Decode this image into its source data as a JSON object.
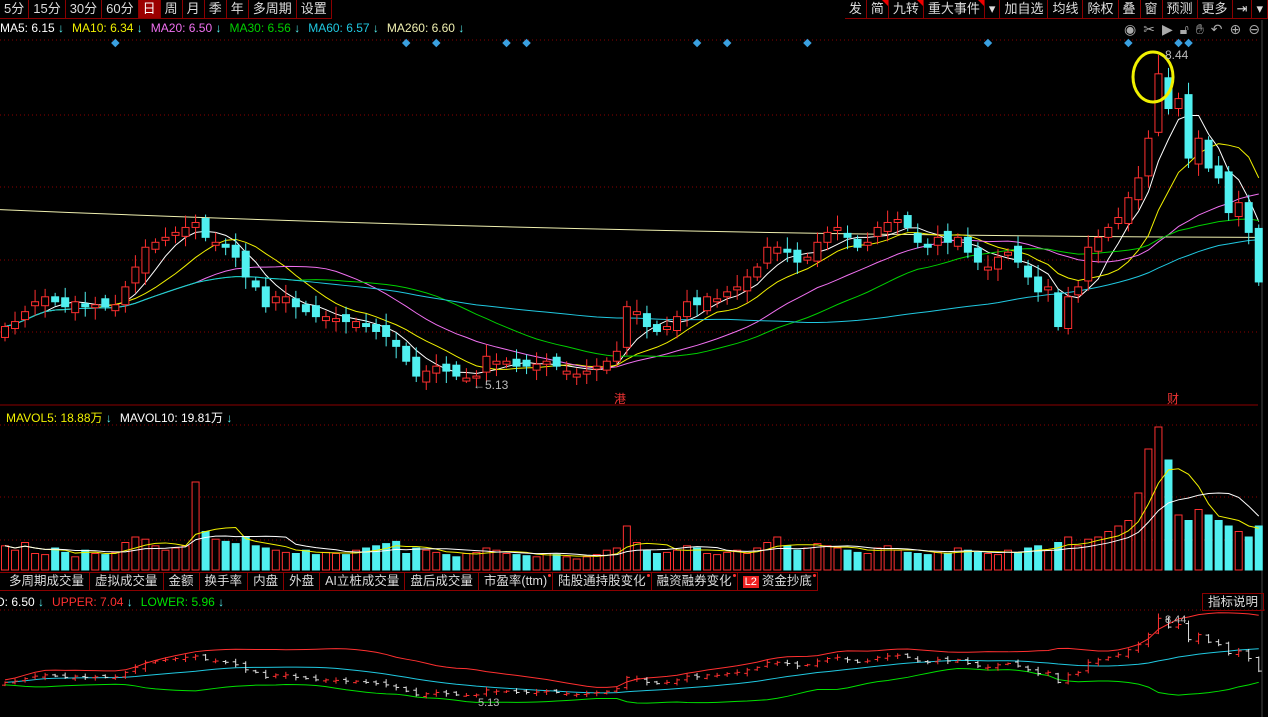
{
  "toolbar": {
    "periods": [
      "5分",
      "15分",
      "30分",
      "60分",
      "日",
      "周",
      "月",
      "季",
      "年",
      "多周期",
      "设置"
    ],
    "active": "日",
    "right": [
      "发",
      "简",
      "九转",
      "重大事件",
      "▾",
      "加自选",
      "均线",
      "除权",
      "叠",
      "窗",
      "预测",
      "更多",
      "⇥",
      "▾"
    ]
  },
  "tools": [
    "eye-icon",
    "scissors-icon",
    "play-icon",
    "lock-icon",
    "hand-icon",
    "undo-icon",
    "zoom-in-icon",
    "zoom-out-icon"
  ],
  "ma_legend": [
    {
      "label": "MA5: 6.15",
      "color": "#ffffff"
    },
    {
      "label": "MA10: 6.34",
      "color": "#f0f000"
    },
    {
      "label": "MA20: 6.50",
      "color": "#f070f0"
    },
    {
      "label": "MA30: 6.56",
      "color": "#00d000"
    },
    {
      "label": "MA60: 6.57",
      "color": "#20c8e0"
    },
    {
      "label": "MA260: 6.60",
      "color": "#f0f0b0"
    }
  ],
  "vol_legend": [
    {
      "label": "MAVOL5: 18.88万",
      "color": "#f0f000"
    },
    {
      "label": "MAVOL10: 19.81万",
      "color": "#ffffff"
    }
  ],
  "tabs": [
    "多周期成交量",
    "虚拟成交量",
    "金额",
    "换手率",
    "内盘",
    "外盘",
    "AI立桩成交量",
    "盘后成交量",
    "市盈率(ttm)",
    "陆股通持股变化",
    "融资融券变化",
    "资金抄底"
  ],
  "tab_l2": "L2",
  "boll_legend": [
    {
      "label": "D: 6.50",
      "color": "#ffffff"
    },
    {
      "label": "UPPER: 7.04",
      "color": "#ff3030"
    },
    {
      "label": "LOWER: 5.96",
      "color": "#00e000"
    }
  ],
  "explain_label": "指标说明",
  "marks": {
    "high": "8.44",
    "low": "5.13",
    "gang": "港",
    "cai": "财"
  },
  "arrow": "↓",
  "colors": {
    "up": "#ff3030",
    "down": "#50f0f0",
    "grid": "#8b0000"
  },
  "chart_data": {
    "type": "candlestick",
    "closes": [
      5.7,
      5.75,
      5.85,
      5.95,
      6.0,
      5.95,
      5.9,
      5.95,
      5.9,
      5.92,
      5.9,
      5.92,
      6.1,
      6.3,
      6.5,
      6.55,
      6.6,
      6.65,
      6.7,
      6.75,
      6.6,
      6.55,
      6.5,
      6.4,
      6.2,
      6.1,
      5.9,
      6.0,
      6.0,
      5.9,
      5.85,
      5.8,
      5.8,
      5.78,
      5.75,
      5.75,
      5.7,
      5.65,
      5.6,
      5.5,
      5.35,
      5.2,
      5.25,
      5.3,
      5.25,
      5.2,
      5.18,
      5.2,
      5.4,
      5.35,
      5.35,
      5.3,
      5.3,
      5.32,
      5.35,
      5.3,
      5.25,
      5.22,
      5.25,
      5.3,
      5.35,
      5.45,
      5.9,
      5.85,
      5.7,
      5.65,
      5.7,
      5.8,
      5.95,
      5.92,
      6.0,
      5.98,
      6.05,
      6.1,
      6.2,
      6.3,
      6.5,
      6.5,
      6.45,
      6.35,
      6.4,
      6.55,
      6.65,
      6.7,
      6.6,
      6.5,
      6.55,
      6.7,
      6.75,
      6.78,
      6.7,
      6.55,
      6.5,
      6.6,
      6.55,
      6.6,
      6.45,
      6.35,
      6.3,
      6.4,
      6.45,
      6.35,
      6.2,
      6.05,
      6.1,
      5.7,
      6.0,
      6.1,
      6.5,
      6.6,
      6.7,
      6.8,
      7.0,
      7.2,
      7.6,
      8.25,
      7.9,
      8.0,
      7.4,
      7.6,
      7.3,
      7.2,
      6.85,
      6.95,
      6.65,
      6.15
    ],
    "volumes": [
      22,
      18,
      25,
      15,
      14,
      20,
      16,
      12,
      18,
      15,
      14,
      16,
      25,
      30,
      28,
      22,
      18,
      20,
      22,
      80,
      35,
      28,
      26,
      24,
      30,
      22,
      20,
      18,
      16,
      15,
      18,
      14,
      16,
      15,
      14,
      18,
      20,
      22,
      24,
      26,
      15,
      20,
      18,
      16,
      14,
      12,
      15,
      16,
      20,
      18,
      15,
      14,
      13,
      12,
      15,
      14,
      12,
      10,
      12,
      14,
      18,
      20,
      40,
      25,
      18,
      15,
      16,
      18,
      22,
      20,
      15,
      14,
      16,
      18,
      15,
      20,
      25,
      30,
      22,
      18,
      20,
      24,
      22,
      20,
      18,
      16,
      15,
      20,
      22,
      18,
      16,
      15,
      14,
      16,
      15,
      20,
      18,
      16,
      15,
      14,
      18,
      16,
      20,
      22,
      18,
      25,
      30,
      22,
      28,
      30,
      35,
      40,
      45,
      70,
      110,
      130,
      100,
      50,
      45,
      55,
      50,
      45,
      40,
      35,
      30,
      40
    ],
    "events": [
      11,
      40,
      43,
      50,
      52,
      69,
      72,
      80,
      98,
      112,
      117,
      118
    ],
    "high": 8.44,
    "low": 5.13,
    "ma260_range": [
      6.88,
      6.6
    ]
  }
}
